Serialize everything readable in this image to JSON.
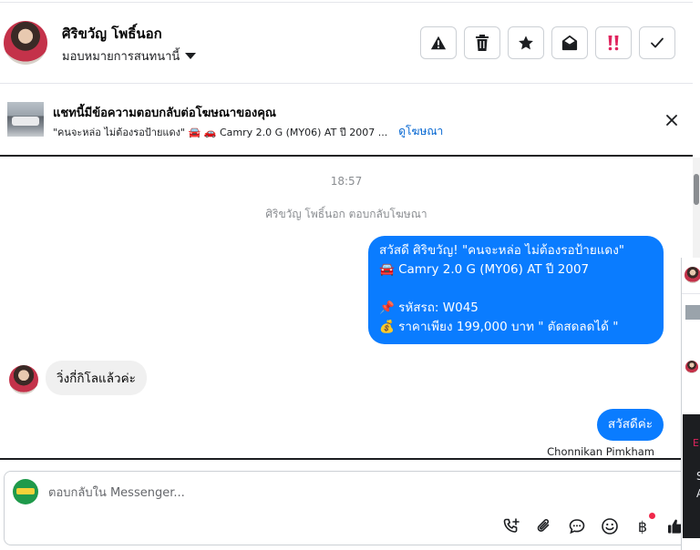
{
  "header": {
    "contact_name": "ศิริขวัญ โพธิ์นอก",
    "assign_label": "มอบหมายการสนทนานี้",
    "toolbar": [
      {
        "name": "report-spam-button",
        "icon": "warning-icon"
      },
      {
        "name": "delete-button",
        "icon": "trash-icon"
      },
      {
        "name": "star-button",
        "icon": "star-icon"
      },
      {
        "name": "mark-unread-button",
        "icon": "envelope-open-icon"
      },
      {
        "name": "follow-up-button",
        "icon": "double-exclamation-icon"
      },
      {
        "name": "mark-done-button",
        "icon": "check-icon"
      }
    ]
  },
  "banner": {
    "title": "แชทนี้มีข้อความตอบกลับต่อโฆษณาของคุณ",
    "ad_text": "\"คนจะหล่อ ไม่ต้องรอป้ายแดง\" 🚘 🚗 Camry 2.0 G (MY06) AT ปี 2007 ...",
    "link": "ดูโฆษณา"
  },
  "chat": {
    "timestamp": "18:57",
    "system_note": "ศิริขวัญ โพธิ์นอก ตอบกลับโฆษณา",
    "ad_message_lines": [
      "สวัสดี ศิริขวัญ! \"คนจะหล่อ ไม่ต้องรอป้ายแดง\"",
      "🚘 Camry 2.0 G (MY06) AT ปี 2007",
      "",
      "📌 รหัสรถ: W045",
      "💰 ราคาเพียง 199,000 บาท \" ตัดสดลดได้ \""
    ],
    "incoming_message": "วิ่งกี่กิโลแล้วค่ะ",
    "outgoing_message": "สวัสดีค่ะ",
    "sender_name": "Chonnikan Pimkham"
  },
  "composer": {
    "placeholder": "ตอบกลับใน Messenger...",
    "baht_symbol": "฿"
  },
  "side_panel": {
    "chars": [
      "E",
      "S",
      "A"
    ]
  },
  "colors": {
    "accent": "#0a7cff",
    "incoming_bubble": "#f0f0f0",
    "link": "#0064d1",
    "badge": "#f0284a"
  }
}
